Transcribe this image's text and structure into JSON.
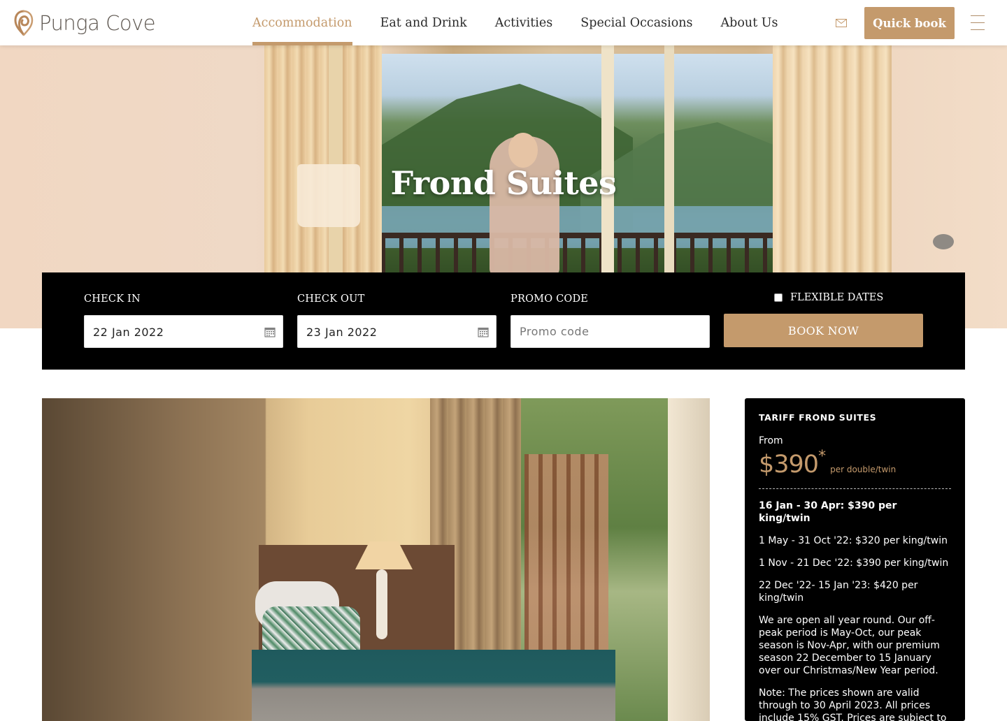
{
  "header": {
    "logo_text": "Punga Cove",
    "nav": [
      {
        "label": "Accommodation",
        "active": true
      },
      {
        "label": "Eat and Drink",
        "active": false
      },
      {
        "label": "Activities",
        "active": false
      },
      {
        "label": "Special Occasions",
        "active": false
      },
      {
        "label": "About Us",
        "active": false
      }
    ],
    "quick_book_label": "Quick book",
    "mail_icon": "mail-icon",
    "menu_icon": "hamburger-menu-icon"
  },
  "hero": {
    "title": "Frond Suites"
  },
  "booking": {
    "check_in_label": "CHECK IN",
    "check_in_value": "22 Jan 2022",
    "check_out_label": "CHECK OUT",
    "check_out_value": "23 Jan 2022",
    "promo_label": "PROMO CODE",
    "promo_placeholder": "Promo code",
    "flexible_label": "FLEXIBLE DATES",
    "flexible_checked": false,
    "book_now_label": "BOOK NOW"
  },
  "tariff": {
    "title": "TARIFF FROND SUITES",
    "from_label": "From",
    "price": "$390",
    "price_star": "*",
    "price_unit": "per double/twin",
    "rates": [
      {
        "text": "16 Jan - 30 Apr: $390 per king/twin",
        "bold": true
      },
      {
        "text": "1 May - 31 Oct '22: $320 per king/twin",
        "bold": false
      },
      {
        "text": "1 Nov - 21 Dec '22: $390 per king/twin",
        "bold": false
      },
      {
        "text": "22 Dec '22- 15 Jan '23: $420 per king/twin",
        "bold": false
      }
    ],
    "season_note": "We are open all year round. Our off-peak period is May-Oct, our peak season is Nov-Apr, with our premium season 22 December to 15 January over our Christmas/New Year period.",
    "price_note": "Note: The prices shown are valid through to 30 April 2023. All prices include 15% GST. Prices are subject to"
  },
  "colors": {
    "accent": "#c49a6c",
    "dark": "#000000",
    "nav_text": "#2b2b2b"
  }
}
